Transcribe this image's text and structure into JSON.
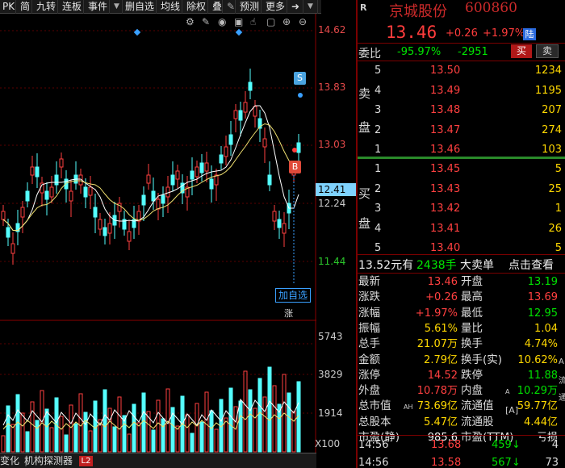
{
  "toolbar": {
    "items": [
      "PK",
      "简",
      "九转",
      "连板",
      "事件",
      "删自选",
      "均线",
      "除权",
      "叠",
      "预测",
      "更多"
    ],
    "dropdown_glyph": "▼"
  },
  "price_axis": [
    "14.62",
    "13.83",
    "13.03",
    "12.41",
    "12.24",
    "11.44"
  ],
  "volume_axis": [
    "5743",
    "3829",
    "1914",
    "X100"
  ],
  "chart_markers": {
    "s_label": "S",
    "b_label": "B",
    "add_watch": "加自选",
    "zhang": "涨"
  },
  "bottom_tabs": [
    "变化",
    "机构探测器",
    "L2"
  ],
  "header": {
    "market": "R",
    "name": "京城股份",
    "code": "600860",
    "price": "13.46",
    "change": "+0.26",
    "pct": "+1.97%",
    "badge": "陆"
  },
  "weibi": {
    "label": "委比",
    "pct": "-95.97%",
    "diff": "-2951",
    "buy": "买",
    "sell": "卖"
  },
  "side_labels": {
    "sell_top": "卖",
    "sell_bottom": "盘",
    "buy_top": "买",
    "buy_bottom": "盘"
  },
  "sell_orders": [
    {
      "level": "5",
      "price": "13.50",
      "vol": "1234"
    },
    {
      "level": "4",
      "price": "13.49",
      "vol": "1195"
    },
    {
      "level": "3",
      "price": "13.48",
      "vol": "207"
    },
    {
      "level": "2",
      "price": "13.47",
      "vol": "274"
    },
    {
      "level": "1",
      "price": "13.46",
      "vol": "103"
    }
  ],
  "buy_orders": [
    {
      "level": "1",
      "price": "13.45",
      "vol": "5"
    },
    {
      "level": "2",
      "price": "13.43",
      "vol": "25"
    },
    {
      "level": "3",
      "price": "13.42",
      "vol": "1"
    },
    {
      "level": "4",
      "price": "13.41",
      "vol": "26"
    },
    {
      "level": "5",
      "price": "13.40",
      "vol": "5"
    }
  ],
  "big_order": {
    "price": "13.52元有",
    "vol": "2438手",
    "label": "大卖单",
    "link": "点击查看"
  },
  "stats": [
    {
      "l1": "最新",
      "v1": "13.46",
      "l2": "开盘",
      "v2": "13.19"
    },
    {
      "l1": "涨跌",
      "v1": "+0.26",
      "l2": "最高",
      "v2": "13.69"
    },
    {
      "l1": "涨幅",
      "v1": "+1.97%",
      "l2": "最低",
      "v2": "12.95"
    },
    {
      "l1": "振幅",
      "v1": "5.61%",
      "l2": "量比",
      "v2": "1.04"
    },
    {
      "l1": "总手",
      "v1": "21.07万",
      "l2": "换手",
      "v2": "4.74%"
    },
    {
      "l1": "金额",
      "v1": "2.79亿",
      "l2": "换手(实)",
      "v2": "10.62%"
    },
    {
      "l1": "涨停",
      "v1": "14.52",
      "l2": "跌停",
      "v2": "11.88"
    },
    {
      "l1": "外盘",
      "v1": "10.78万",
      "l2": "内盘",
      "v2": "10.29万"
    },
    {
      "l1": "总市值",
      "v1": "73.69亿",
      "l2": "流通值",
      "v2": "59.77亿"
    },
    {
      "l1": "总股本",
      "v1": "5.47亿",
      "l2": "流通股",
      "v2": "4.44亿"
    },
    {
      "l1": "市盈(静)",
      "v1": "985.6",
      "l2": "市盈(TTM)",
      "v2": "亏损"
    }
  ],
  "stat_tags": {
    "ah": "AH",
    "a_sup": "A",
    "a_bracket": "[A]",
    "side_a": "A",
    "side_b": "流",
    "side_c": "通"
  },
  "ticks": [
    {
      "time": "14:56",
      "price": "13.68",
      "vol": "459",
      "arrow": "↓",
      "n": "4"
    },
    {
      "time": "14:56",
      "price": "13.58",
      "vol": "567",
      "arrow": "↓",
      "n": "73"
    }
  ]
}
